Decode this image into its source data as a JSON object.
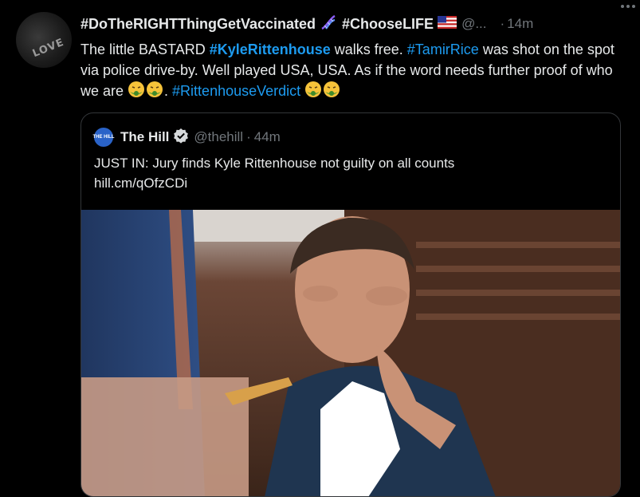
{
  "tweet": {
    "display_name_1": "#DoTheRIGHTThingGetVaccinated",
    "display_name_2": "#ChooseLIFE",
    "handle": "@...",
    "separator": "·",
    "time": "14m",
    "avatar_text": "LOVE",
    "text": {
      "t1": "The little BASTARD ",
      "tag1": "#KyleRittenhouse",
      "t2": " walks free. ",
      "tag2": "#TamirRice",
      "t3": " was shot on the spot via police drive-by. Well played USA, USA. As if the word needs further proof of who we are ",
      "t4": ". ",
      "tag3": "#RittenhouseVerdict"
    }
  },
  "quote": {
    "name": "The Hill",
    "handle": "@thehill",
    "separator": "·",
    "time": "44m",
    "logo_text": "THE HILL",
    "text_line1": "JUST IN: Jury finds Kyle Rittenhouse not guilty on all counts",
    "link": "hill.cm/qOfzCDi"
  },
  "icons": {
    "dna": "dna-icon",
    "flag": "us-flag-icon",
    "verified": "verified-badge-icon",
    "emoji": "nauseated-face-emoji",
    "more": "more-options-icon"
  },
  "colors": {
    "background": "#000000",
    "text": "#e7e9ea",
    "muted": "#71767b",
    "link": "#1d9bf0",
    "border": "#333639"
  }
}
